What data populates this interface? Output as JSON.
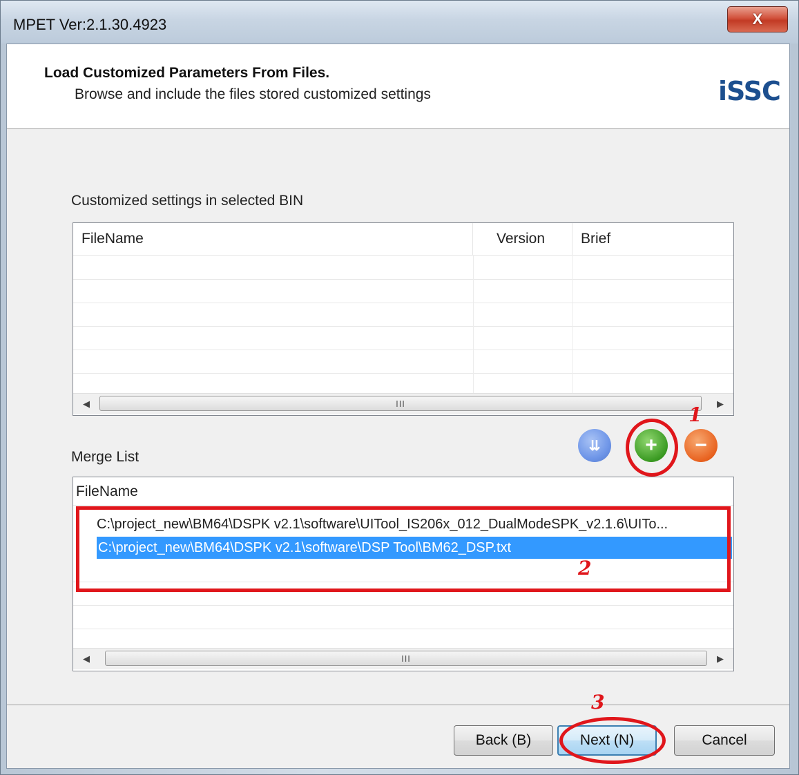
{
  "window": {
    "title": "MPET Ver:2.1.30.4923",
    "close_label": "X"
  },
  "header": {
    "title": "Load Customized Parameters From Files.",
    "subtitle": "Browse and include the files stored customized settings",
    "logo": "iSSC"
  },
  "bin_section": {
    "label": "Customized settings in selected BIN",
    "columns": [
      "FileName",
      "Version",
      "Brief"
    ],
    "rows": [],
    "scroll_thumb": "III"
  },
  "merge_section": {
    "label": "Merge List",
    "columns": [
      "FileName"
    ],
    "rows": [
      "C:\\project_new\\BM64\\DSPK v2.1\\software\\UITool_IS206x_012_DualModeSPK_v2.1.6\\UITo...",
      "C:\\project_new\\BM64\\DSPK v2.1\\software\\DSP Tool\\BM62_DSP.txt"
    ],
    "selected_index": 1,
    "scroll_thumb": "III"
  },
  "toolbar_icons": [
    "move-down-icon",
    "add-icon",
    "remove-icon"
  ],
  "annotations": [
    "1",
    "2",
    "3"
  ],
  "buttons": {
    "back": "Back (B)",
    "next": "Next (N)",
    "cancel": "Cancel"
  },
  "colors": {
    "selection": "#3399ff",
    "annotation": "#e0161b",
    "add": "#3a9a22",
    "remove": "#e8621f",
    "move": "#6f96e8"
  }
}
